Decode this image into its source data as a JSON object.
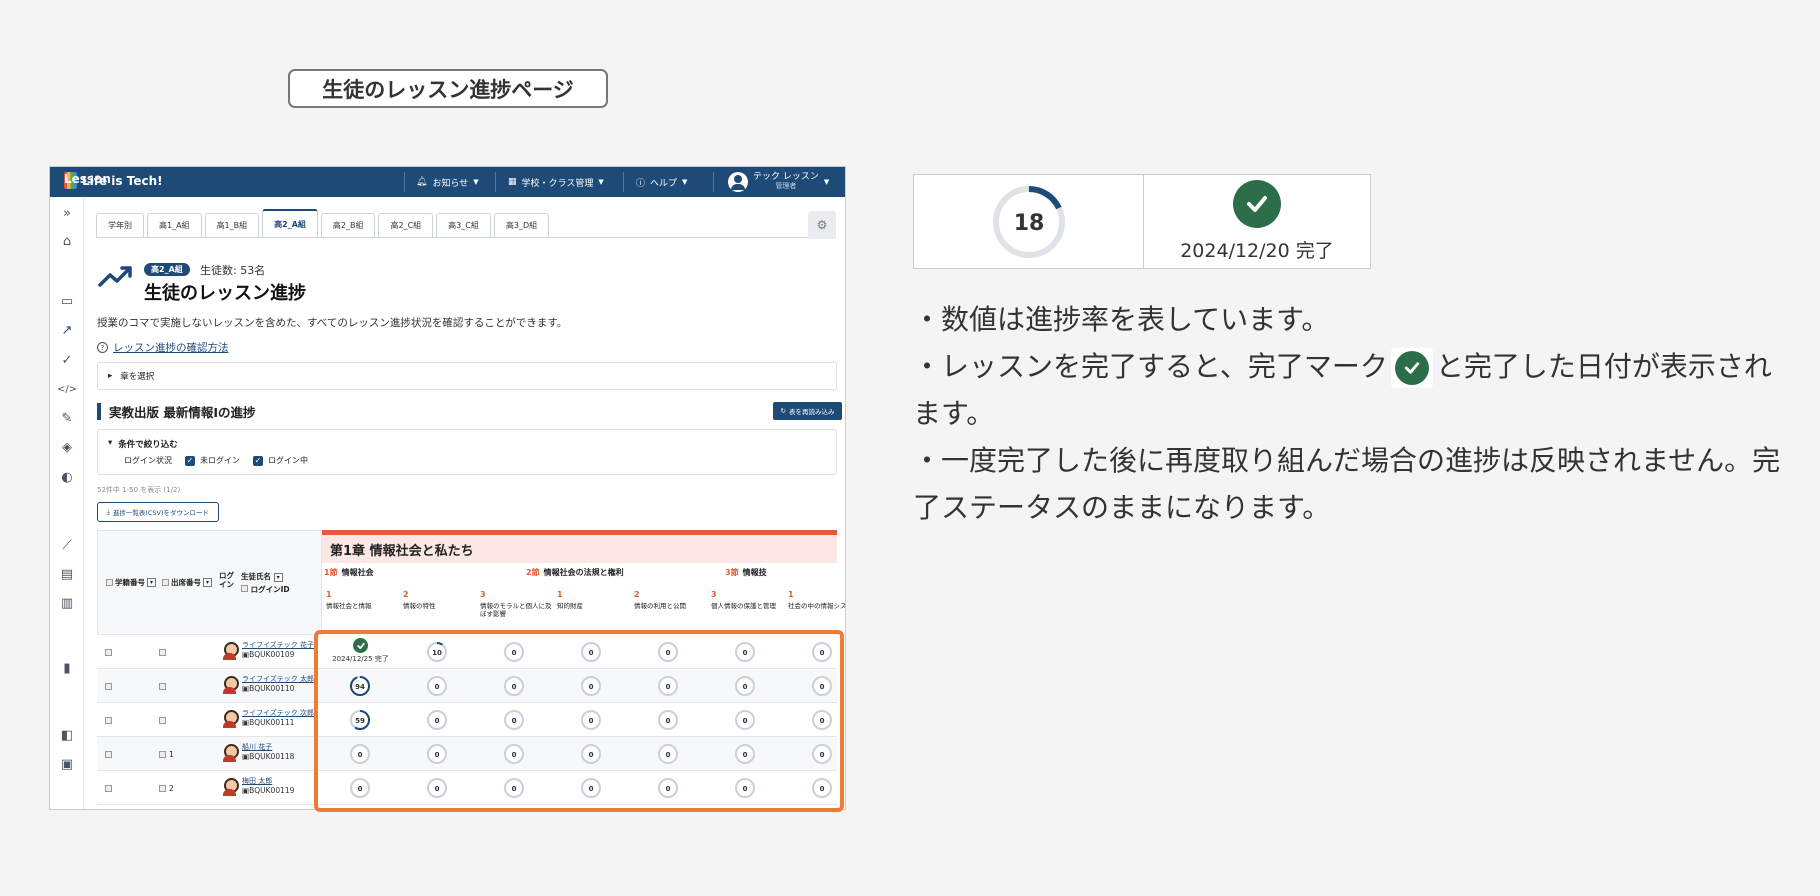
{
  "page_label": "生徒のレッスン進捗ページ",
  "app": {
    "logo_text": "Life is Tech!",
    "logo_sub": "Lesson",
    "nav": {
      "notifications": "お知らせ",
      "school_mgmt": "学校・クラス管理",
      "help": "ヘルプ",
      "user_name": "テック レッスン",
      "user_role": "管理者"
    },
    "tabs": [
      "学年別",
      "高1_A組",
      "高1_B組",
      "高2_A組",
      "高2_B組",
      "高2_C組",
      "高3_C組",
      "高3_D組"
    ],
    "active_tab": "高2_A組",
    "class_badge": "高2_A組",
    "student_count": "生徒数: 53名",
    "title": "生徒のレッスン進捗",
    "description": "授業のコマで実施しないレッスンを含めた、すべてのレッスン進捗状況を確認することができます。",
    "howto_link": "レッスン進捗の確認方法",
    "chapter_select": "章を選択",
    "section_heading": "実教出版 最新情報Iの進捗",
    "reload_button": "表を再読み込み",
    "filter": {
      "title": "条件で絞り込む",
      "login_status": "ログイン状況",
      "not_logged_in": "未ログイン",
      "logged_in": "ログイン中"
    },
    "range_text": "52件中 1-50 を表示 (1/2)",
    "csv_button": "進捗一覧表(CSV)をダウンロード",
    "table": {
      "head": {
        "school_no": "学籍番号",
        "seat_no": "出席番号",
        "login": "ログイン",
        "student_name": "生徒氏名",
        "login_id": "ログインID"
      },
      "chapter": "第1章 情報社会と私たち",
      "sections": [
        {
          "num": "1節",
          "title": "情報社会"
        },
        {
          "num": "2節",
          "title": "情報社会の法規と権利"
        },
        {
          "num": "3節",
          "title": "情報技"
        }
      ],
      "lessons": [
        {
          "num": "1",
          "title": "情報社会と情報"
        },
        {
          "num": "2",
          "title": "情報の特性"
        },
        {
          "num": "3",
          "title": "情報のモラルと個人に及ぼす影響"
        },
        {
          "num": "1",
          "title": "知的財産"
        },
        {
          "num": "2",
          "title": "情報の利用と公開"
        },
        {
          "num": "3",
          "title": "個人情報の保護と管理"
        },
        {
          "num": "1",
          "title": "社会の中の情報システム"
        }
      ],
      "rows": [
        {
          "seat": "",
          "name": "ライフイズテック 花子",
          "id": "BQUK00109",
          "done_date": "2024/12/25 完了",
          "progress": [
            10,
            0,
            0,
            0,
            0,
            0
          ]
        },
        {
          "seat": "",
          "name": "ライフイズテック 太郎",
          "id": "BQUK00110",
          "done_date": "",
          "progress": [
            94,
            0,
            0,
            0,
            0,
            0,
            0
          ]
        },
        {
          "seat": "",
          "name": "ライフイズテック 次郎",
          "id": "BQUK00111",
          "done_date": "",
          "progress": [
            59,
            0,
            0,
            0,
            0,
            0,
            0
          ]
        },
        {
          "seat": "1",
          "name": "船川 花子",
          "id": "BQUK00118",
          "done_date": "",
          "progress": [
            0,
            0,
            0,
            0,
            0,
            0,
            0
          ]
        },
        {
          "seat": "2",
          "name": "梅田 太郎",
          "id": "BQUK00119",
          "done_date": "",
          "progress": [
            0,
            0,
            0,
            0,
            0,
            0,
            0
          ]
        }
      ]
    }
  },
  "legend": {
    "progress_value": "18",
    "progress_fraction": 0.18,
    "done_text": "2024/12/20 完了"
  },
  "notes": {
    "line1": "・数値は進捗率を表しています。",
    "line2a": "・レッスンを完了すると、完了マーク",
    "line2b": "と完了した日付が表示されます。",
    "line3": "・一度完了した後に再度取り組んだ場合の進捗は反映されません。完了ステータスのままになります。"
  },
  "colors": {
    "brand": "#1e4a78",
    "accent": "#e4593a",
    "done_green": "#2c6e49",
    "highlight": "#ef7b35"
  }
}
